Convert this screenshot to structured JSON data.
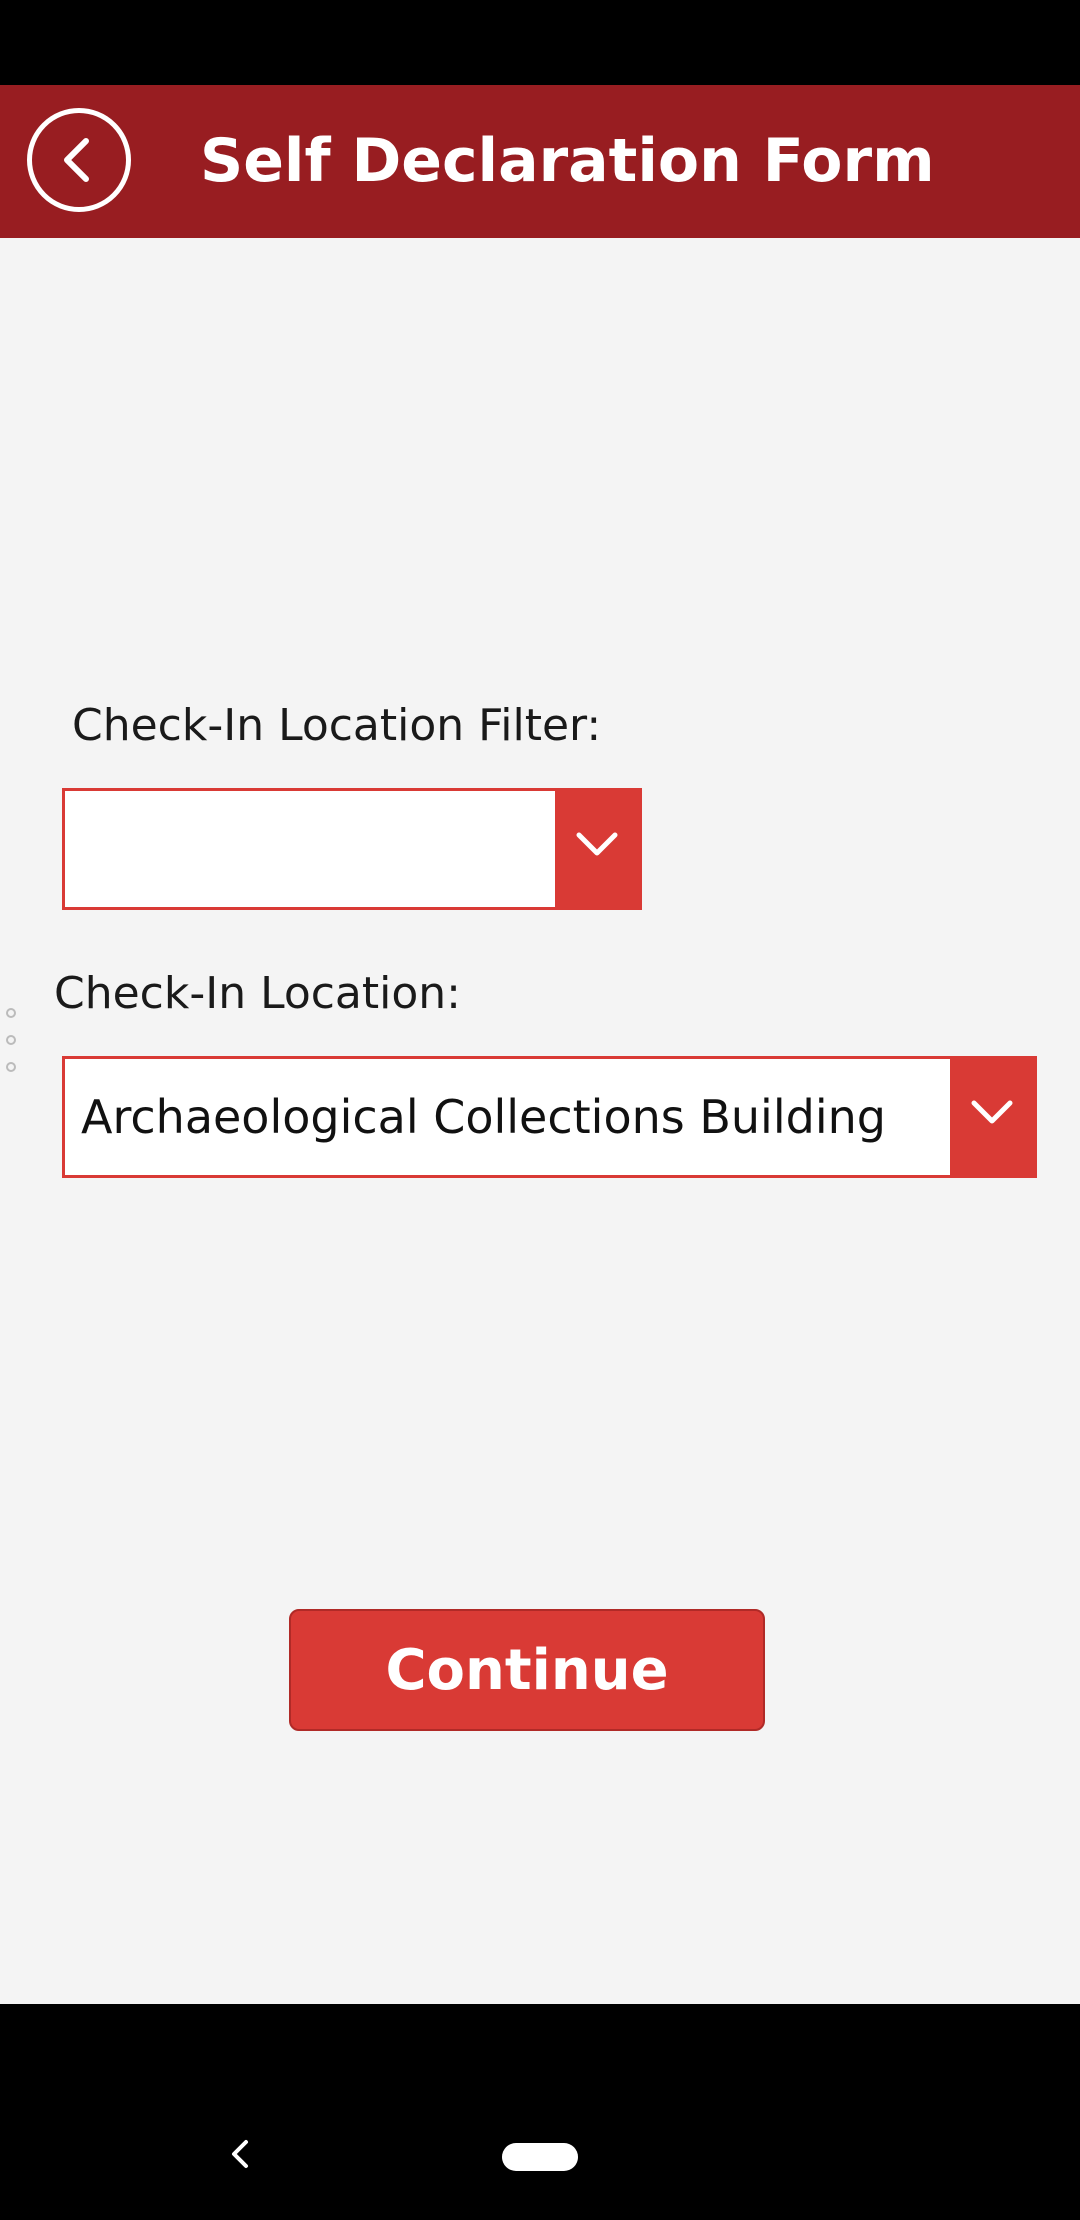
{
  "header": {
    "title": "Self Declaration Form",
    "back_icon": "chevron-left-icon"
  },
  "filter": {
    "label": "Check-In Location Filter:",
    "value": ""
  },
  "location": {
    "label": "Check-In Location:",
    "value": "Archaeological Collections Building"
  },
  "actions": {
    "continue_label": "Continue"
  },
  "colors": {
    "header_bg": "#981d21",
    "accent": "#d93a35",
    "background": "#f4f4f4"
  }
}
